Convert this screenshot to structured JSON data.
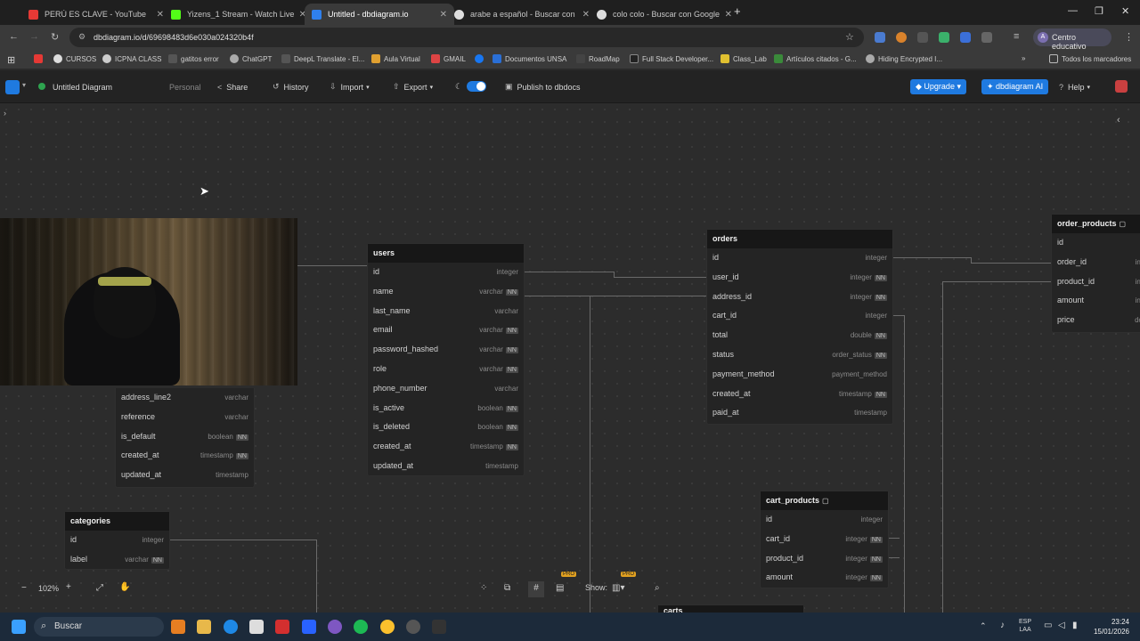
{
  "browser": {
    "tabs": [
      {
        "title": "PERÚ ES CLAVE - YouTube",
        "color": "#e53935"
      },
      {
        "title": "Yizens_1 Stream - Watch Live on",
        "color": "#53fc18"
      },
      {
        "title": "Untitled - dbdiagram.io",
        "color": "#2f80ed"
      },
      {
        "title": "arabe a español - Buscar con G",
        "color": "#dddddd"
      },
      {
        "title": "colo colo - Buscar con Google",
        "color": "#dddddd"
      }
    ],
    "url": "dbdiagram.io/d/69698483d6e030a024320b4f",
    "profile_label": "Centro educativo",
    "bookmarks": [
      "CURSOS",
      "ICPNA CLASS",
      "gatitos error",
      "ChatGPT",
      "DeepL Translate - El...",
      "Aula Virtual",
      "GMAIL",
      "Documentos UNSA",
      "RoadMap",
      "Full Stack Developer...",
      "Class_Lab",
      "Artículos citados - G...",
      "Hiding Encrypted I...",
      "Todos los marcadores"
    ]
  },
  "app": {
    "doc_title": "Untitled Diagram",
    "workspace": "Personal",
    "share": "Share",
    "history": "History",
    "import": "Import",
    "export": "Export",
    "publish": "Publish to dbdocs",
    "upgrade": "Upgrade",
    "ai": "dbdiagram AI",
    "help": "Help"
  },
  "tables": {
    "users": {
      "name": "users",
      "rows": [
        {
          "col": "id",
          "type": "integer",
          "nn": ""
        },
        {
          "col": "name",
          "type": "varchar",
          "nn": "NN"
        },
        {
          "col": "last_name",
          "type": "varchar",
          "nn": ""
        },
        {
          "col": "email",
          "type": "varchar",
          "nn": "NN"
        },
        {
          "col": "password_hashed",
          "type": "varchar",
          "nn": "NN"
        },
        {
          "col": "role",
          "type": "varchar",
          "nn": "NN"
        },
        {
          "col": "phone_number",
          "type": "varchar",
          "nn": ""
        },
        {
          "col": "is_active",
          "type": "boolean",
          "nn": "NN"
        },
        {
          "col": "is_deleted",
          "type": "boolean",
          "nn": "NN"
        },
        {
          "col": "created_at",
          "type": "timestamp",
          "nn": "NN"
        },
        {
          "col": "updated_at",
          "type": "timestamp",
          "nn": ""
        }
      ]
    },
    "orders": {
      "name": "orders",
      "rows": [
        {
          "col": "id",
          "type": "integer",
          "nn": ""
        },
        {
          "col": "user_id",
          "type": "integer",
          "nn": "NN"
        },
        {
          "col": "address_id",
          "type": "integer",
          "nn": "NN"
        },
        {
          "col": "cart_id",
          "type": "integer",
          "nn": ""
        },
        {
          "col": "total",
          "type": "double",
          "nn": "NN"
        },
        {
          "col": "status",
          "type": "order_status",
          "nn": "NN"
        },
        {
          "col": "payment_method",
          "type": "payment_method",
          "nn": ""
        },
        {
          "col": "created_at",
          "type": "timestamp",
          "nn": "NN"
        },
        {
          "col": "paid_at",
          "type": "timestamp",
          "nn": ""
        }
      ]
    },
    "order_products": {
      "name": "order_products",
      "rows": [
        {
          "col": "id",
          "type": "",
          "nn": ""
        },
        {
          "col": "order_id",
          "type": "int",
          "nn": ""
        },
        {
          "col": "product_id",
          "type": "int",
          "nn": ""
        },
        {
          "col": "amount",
          "type": "int",
          "nn": ""
        },
        {
          "col": "price",
          "type": "do",
          "nn": ""
        }
      ]
    },
    "cart_products": {
      "name": "cart_products",
      "rows": [
        {
          "col": "id",
          "type": "integer",
          "nn": ""
        },
        {
          "col": "cart_id",
          "type": "integer",
          "nn": "NN"
        },
        {
          "col": "product_id",
          "type": "integer",
          "nn": "NN"
        },
        {
          "col": "amount",
          "type": "integer",
          "nn": "NN"
        }
      ]
    },
    "categories": {
      "name": "categories",
      "rows": [
        {
          "col": "id",
          "type": "integer",
          "nn": ""
        },
        {
          "col": "label",
          "type": "varchar",
          "nn": "NN"
        }
      ]
    },
    "addresses_partial": {
      "rows": [
        {
          "col": "address_line2",
          "type": "varchar",
          "nn": ""
        },
        {
          "col": "reference",
          "type": "varchar",
          "nn": ""
        },
        {
          "col": "is_default",
          "type": "boolean",
          "nn": "NN"
        },
        {
          "col": "created_at",
          "type": "timestamp",
          "nn": "NN"
        },
        {
          "col": "updated_at",
          "type": "timestamp",
          "nn": ""
        }
      ]
    },
    "carts_label": "carts"
  },
  "controls": {
    "zoom": "102%",
    "show": "Show:",
    "pro": "PRO"
  },
  "taskbar": {
    "search": "Buscar",
    "lang1": "ESP",
    "lang2": "LAA",
    "time": "23:24",
    "date": "15/01/2026"
  }
}
